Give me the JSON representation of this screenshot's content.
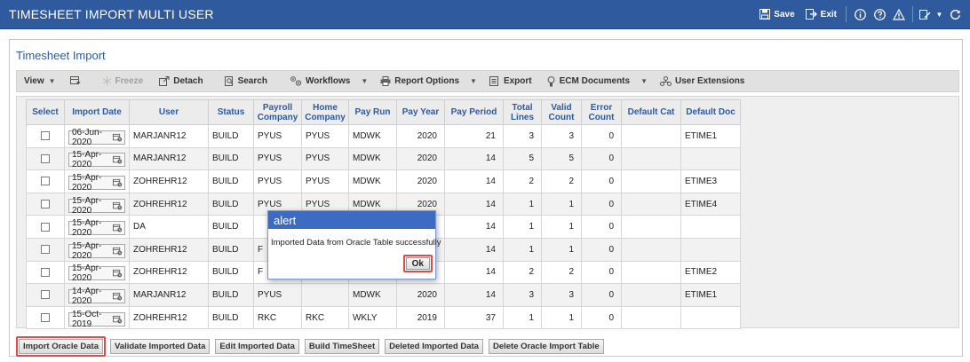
{
  "app": {
    "title": "TIMESHEET IMPORT MULTI USER",
    "save_label": "Save",
    "exit_label": "Exit"
  },
  "panel": {
    "title": "Timesheet Import"
  },
  "toolbar": {
    "view": "View",
    "freeze": "Freeze",
    "detach": "Detach",
    "search": "Search",
    "workflows": "Workflows",
    "report_options": "Report Options",
    "export": "Export",
    "ecm_documents": "ECM Documents",
    "user_extensions": "User Extensions"
  },
  "table": {
    "headers": {
      "select": "Select",
      "import_date": "Import Date",
      "user": "User",
      "status": "Status",
      "payroll_company_1": "Payroll",
      "payroll_company_2": "Company",
      "home_company_1": "Home",
      "home_company_2": "Company",
      "pay_run": "Pay Run",
      "pay_year": "Pay Year",
      "pay_period": "Pay Period",
      "total_lines_1": "Total",
      "total_lines_2": "Lines",
      "valid_count_1": "Valid",
      "valid_count_2": "Count",
      "error_count_1": "Error",
      "error_count_2": "Count",
      "default_cat": "Default Cat",
      "default_doc": "Default Doc"
    },
    "rows": [
      {
        "date": "06-Jun-2020",
        "user": "MARJANR12",
        "status": "BUILD",
        "payroll": "PYUS",
        "home": "PYUS",
        "run": "MDWK",
        "year": "2020",
        "period": "21",
        "total": "3",
        "valid": "3",
        "error": "0",
        "cat": "",
        "doc": "ETIME1"
      },
      {
        "date": "15-Apr-2020",
        "user": "MARJANR12",
        "status": "BUILD",
        "payroll": "PYUS",
        "home": "PYUS",
        "run": "MDWK",
        "year": "2020",
        "period": "14",
        "total": "5",
        "valid": "5",
        "error": "0",
        "cat": "",
        "doc": ""
      },
      {
        "date": "15-Apr-2020",
        "user": "ZOHREHR12",
        "status": "BUILD",
        "payroll": "PYUS",
        "home": "PYUS",
        "run": "MDWK",
        "year": "2020",
        "period": "14",
        "total": "2",
        "valid": "2",
        "error": "0",
        "cat": "",
        "doc": "ETIME3"
      },
      {
        "date": "15-Apr-2020",
        "user": "ZOHREHR12",
        "status": "BUILD",
        "payroll": "PYUS",
        "home": "PYUS",
        "run": "MDWK",
        "year": "2020",
        "period": "14",
        "total": "1",
        "valid": "1",
        "error": "0",
        "cat": "",
        "doc": "ETIME4"
      },
      {
        "date": "15-Apr-2020",
        "user": "DA",
        "status": "BUILD",
        "payroll": "",
        "home": "",
        "run": "",
        "year": "",
        "period": "14",
        "total": "1",
        "valid": "1",
        "error": "0",
        "cat": "",
        "doc": ""
      },
      {
        "date": "15-Apr-2020",
        "user": "ZOHREHR12",
        "status": "BUILD",
        "payroll": "F",
        "home": "",
        "run": "",
        "year": "",
        "period": "14",
        "total": "1",
        "valid": "1",
        "error": "0",
        "cat": "",
        "doc": ""
      },
      {
        "date": "15-Apr-2020",
        "user": "ZOHREHR12",
        "status": "BUILD",
        "payroll": "F",
        "home": "",
        "run": "",
        "year": "",
        "period": "14",
        "total": "2",
        "valid": "2",
        "error": "0",
        "cat": "",
        "doc": "ETIME2"
      },
      {
        "date": "14-Apr-2020",
        "user": "MARJANR12",
        "status": "BUILD",
        "payroll": "PYUS",
        "home": "",
        "run": "MDWK",
        "year": "2020",
        "period": "14",
        "total": "3",
        "valid": "3",
        "error": "0",
        "cat": "",
        "doc": "ETIME1"
      },
      {
        "date": "15-Oct-2019",
        "user": "ZOHREHR12",
        "status": "BUILD",
        "payroll": "RKC",
        "home": "RKC",
        "run": "WKLY",
        "year": "2019",
        "period": "37",
        "total": "1",
        "valid": "1",
        "error": "0",
        "cat": "",
        "doc": ""
      }
    ]
  },
  "buttons": {
    "import_oracle_data": "Import Oracle Data",
    "validate_imported_data": "Validate Imported Data",
    "edit_imported_data": "Edit Imported Data",
    "build_timesheet": "Build TimeSheet",
    "deleted_imported_data": "Deleted Imported Data",
    "delete_oracle_import_table": "Delete Oracle Import Table"
  },
  "alert": {
    "title": "alert",
    "message": "Imported Data from Oracle Table successfully",
    "ok_label": "Ok"
  },
  "colors": {
    "titlebar": "#2f5a9e",
    "header_text": "#2f5a9e",
    "alert_header": "#3d6bc4",
    "highlight": "#e04a4a"
  }
}
